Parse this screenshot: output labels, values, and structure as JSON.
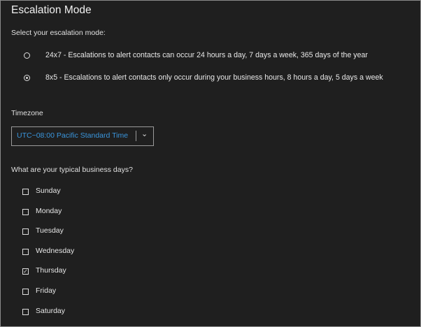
{
  "title": "Escalation Mode",
  "mode_prompt": "Select your escalation mode:",
  "modes": [
    {
      "label": "24x7 - Escalations to alert contacts can occur 24 hours a day, 7 days a week, 365 days of the year",
      "selected": false
    },
    {
      "label": "8x5 - Escalations to alert contacts only occur during your business hours, 8 hours a day, 5 days a week",
      "selected": true
    }
  ],
  "timezone": {
    "label": "Timezone",
    "value": "UTC−08:00 Pacific Standard Time"
  },
  "days_prompt": "What are your typical business days?",
  "days": [
    {
      "label": "Sunday",
      "checked": false
    },
    {
      "label": "Monday",
      "checked": false
    },
    {
      "label": "Tuesday",
      "checked": false
    },
    {
      "label": "Wednesday",
      "checked": false
    },
    {
      "label": "Thursday",
      "checked": true
    },
    {
      "label": "Friday",
      "checked": false
    },
    {
      "label": "Saturday",
      "checked": false
    }
  ]
}
